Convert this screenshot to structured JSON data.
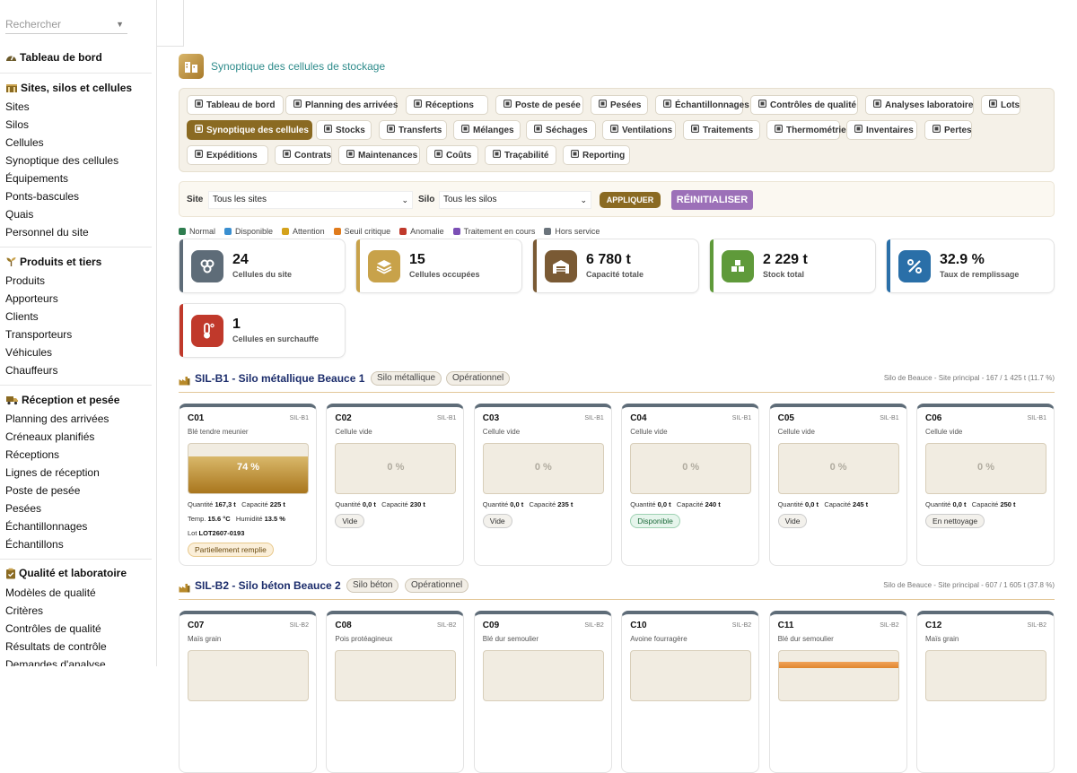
{
  "sidebar": {
    "search_placeholder": "Rechercher",
    "dashboard": "Tableau de bord",
    "sections": [
      {
        "title": "Sites, silos et cellules",
        "items": [
          "Sites",
          "Silos",
          "Cellules",
          "Synoptique des cellules",
          "Équipements",
          "Ponts-bascules",
          "Quais",
          "Personnel du site"
        ]
      },
      {
        "title": "Produits et tiers",
        "items": [
          "Produits",
          "Apporteurs",
          "Clients",
          "Transporteurs",
          "Véhicules",
          "Chauffeurs"
        ]
      },
      {
        "title": "Réception et pesée",
        "items": [
          "Planning des arrivées",
          "Créneaux planifiés",
          "Réceptions",
          "Lignes de réception",
          "Poste de pesée",
          "Pesées",
          "Échantillonnages",
          "Échantillons"
        ]
      },
      {
        "title": "Qualité et laboratoire",
        "items": [
          "Modèles de qualité",
          "Critères",
          "Contrôles de qualité",
          "Résultats de contrôle",
          "Demandes d'analyse"
        ]
      }
    ]
  },
  "page": {
    "title": "Synoptique des cellules de stockage"
  },
  "tabs": [
    [
      "Tableau de bord",
      "Planning des arrivées",
      "Réceptions",
      "Poste de pesée",
      "Pesées",
      "Échantillonnages",
      "Contrôles de qualité",
      "Analyses laboratoire",
      "Lots"
    ],
    [
      "Synoptique des cellules",
      "Stocks",
      "Transferts",
      "Mélanges",
      "Séchages",
      "Ventilations",
      "Traitements",
      "Thermométrie",
      "Inventaires",
      "Pertes"
    ],
    [
      "Expéditions",
      "Contrats",
      "Maintenances",
      "Coûts",
      "Traçabilité",
      "Reporting"
    ]
  ],
  "filters": {
    "site_label": "Site",
    "site_value": "Tous les sites",
    "silo_label": "Silo",
    "silo_value": "Tous les silos",
    "apply": "APPLIQUER",
    "reset": "RÉINITIALISER"
  },
  "legend": [
    {
      "label": "Normal",
      "color": "#2e7d4f"
    },
    {
      "label": "Disponible",
      "color": "#3a8fd0"
    },
    {
      "label": "Attention",
      "color": "#d4a21c"
    },
    {
      "label": "Seuil critique",
      "color": "#e07b1c"
    },
    {
      "label": "Anomalie",
      "color": "#c0392b"
    },
    {
      "label": "Traitement en cours",
      "color": "#7b4fb5"
    },
    {
      "label": "Hors service",
      "color": "#6b747c"
    }
  ],
  "kpis": [
    {
      "value": "24",
      "label": "Cellules du site",
      "color": "#5e6c78"
    },
    {
      "value": "15",
      "label": "Cellules occupées",
      "color": "#c8a24a"
    },
    {
      "value": "6 780 t",
      "label": "Capacité totale",
      "color": "#7a5a34"
    },
    {
      "value": "2 229 t",
      "label": "Stock total",
      "color": "#5f9a3a"
    },
    {
      "value": "32.9 %",
      "label": "Taux de remplissage",
      "color": "#2a6fa8"
    },
    {
      "value": "1",
      "label": "Cellules en surchauffe",
      "color": "#c0392b"
    }
  ],
  "labels": {
    "quantite": "Quantité",
    "capacite": "Capacité",
    "temp": "Temp.",
    "humidite": "Humidité",
    "lot": "Lot"
  },
  "silos": [
    {
      "code": "SIL-B1",
      "title": "SIL-B1 - Silo métallique Beauce 1",
      "type_badge": "Silo métallique",
      "state_badge": "Opérationnel",
      "info": "Silo de Beauce - Site principal - 167 / 1 425 t (11.7 %)",
      "cells": [
        {
          "id": "C01",
          "product": "Blé tendre meunier",
          "fill": 0.74,
          "pct": "74 %",
          "qty": "167,3 t",
          "cap": "225 t",
          "temp": "15.6 °C",
          "hum": "13.5 %",
          "lot": "LOT2607-0193",
          "status": "Partiellement remplie",
          "status_type": "partial"
        },
        {
          "id": "C02",
          "product": "Cellule vide",
          "fill": 0,
          "pct": "0 %",
          "qty": "0,0 t",
          "cap": "230 t",
          "status": "Vide",
          "status_type": "empty"
        },
        {
          "id": "C03",
          "product": "Cellule vide",
          "fill": 0,
          "pct": "0 %",
          "qty": "0,0 t",
          "cap": "235 t",
          "status": "Vide",
          "status_type": "empty"
        },
        {
          "id": "C04",
          "product": "Cellule vide",
          "fill": 0,
          "pct": "0 %",
          "qty": "0,0 t",
          "cap": "240 t",
          "status": "Disponible",
          "status_type": "dispo"
        },
        {
          "id": "C05",
          "product": "Cellule vide",
          "fill": 0,
          "pct": "0 %",
          "qty": "0,0 t",
          "cap": "245 t",
          "status": "Vide",
          "status_type": "empty"
        },
        {
          "id": "C06",
          "product": "Cellule vide",
          "fill": 0,
          "pct": "0 %",
          "qty": "0,0 t",
          "cap": "250 t",
          "status": "En nettoyage",
          "status_type": "empty"
        }
      ]
    },
    {
      "code": "SIL-B2",
      "title": "SIL-B2 - Silo béton Beauce 2",
      "type_badge": "Silo béton",
      "state_badge": "Opérationnel",
      "info": "Silo de Beauce - Site principal - 607 / 1 605 t (37.8 %)",
      "cells": [
        {
          "id": "C07",
          "product": "Maïs grain",
          "fill": 0
        },
        {
          "id": "C08",
          "product": "Pois protéagineux",
          "fill": 0
        },
        {
          "id": "C09",
          "product": "Blé dur semoulier",
          "fill": 0
        },
        {
          "id": "C10",
          "product": "Avoine fourragère",
          "fill": 0
        },
        {
          "id": "C11",
          "product": "Blé dur semoulier",
          "fill": 0,
          "top_band": true
        },
        {
          "id": "C12",
          "product": "Maïs grain",
          "fill": 0
        }
      ]
    }
  ]
}
